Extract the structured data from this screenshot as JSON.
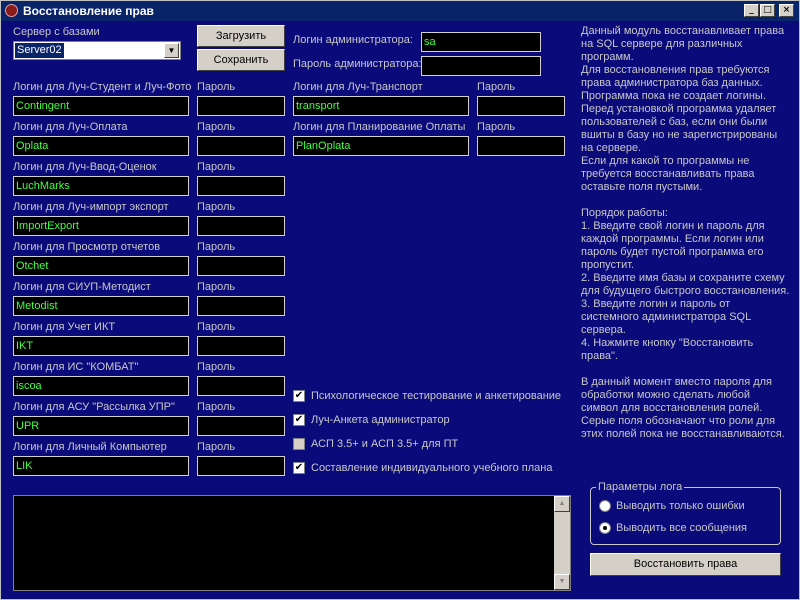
{
  "window": {
    "title": "Восстановление прав",
    "controls": [
      "_",
      "□",
      "×"
    ]
  },
  "server": {
    "label": "Сервер с базами",
    "value": "Server02"
  },
  "buttons": {
    "load": "Загрузить",
    "save": "Сохранить",
    "restore": "Восстановить права"
  },
  "admin": {
    "login_label": "Логин администратора:",
    "login_value": "sa",
    "password_label": "Пароль администратора:",
    "password_value": ""
  },
  "password_label": "Пароль",
  "programs_left": [
    {
      "label": "Логин для Луч-Студент и Луч-Фото",
      "login": "Contingent",
      "password": ""
    },
    {
      "label": "Логин для Луч-Оплата",
      "login": "Oplata",
      "password": ""
    },
    {
      "label": "Логин для Луч-Ввод-Оценок",
      "login": "LuchMarks",
      "password": ""
    },
    {
      "label": "Логин для Луч-импорт экспорт",
      "login": "ImportExport",
      "password": ""
    },
    {
      "label": "Логин для Просмотр отчетов",
      "login": "Otchet",
      "password": ""
    },
    {
      "label": "Логин для СИУП-Методист",
      "login": "Metodist",
      "password": ""
    },
    {
      "label": "Логин для Учет ИКТ",
      "login": "IKT",
      "password": ""
    },
    {
      "label": "Логин для ИС \"КОМБАТ\"",
      "login": "iscoa",
      "password": ""
    },
    {
      "label": "Логин для АСУ \"Рассылка УПР\"",
      "login": "UPR",
      "password": ""
    },
    {
      "label": "Логин для Личный Компьютер",
      "login": "LIK",
      "password": ""
    }
  ],
  "programs_right": [
    {
      "label": "Логин для Луч-Транспорт",
      "login": "transport",
      "password": ""
    },
    {
      "label": "Логин для Планирование Оплаты",
      "login": "PlanOplata",
      "password": ""
    }
  ],
  "checkboxes": [
    {
      "label": "Психологическое тестирование и анкетирование",
      "checked": true
    },
    {
      "label": "Луч-Анкета администратор",
      "checked": true
    },
    {
      "label": "АСП 3.5+ и АСП 3.5+ для ПТ",
      "checked": false
    },
    {
      "label": "Составление индивидуального учебного плана",
      "checked": true
    }
  ],
  "description": [
    "Данный модуль восстанавливает права",
    "на SQL сервере для различных",
    "программ.",
    "Для восстановления прав требуются",
    "права администратора баз данных.",
    "Программа пока не создает логины.",
    "Перед установкой программа удаляет",
    "пользователей с баз, если они были",
    "вшиты в базу но не зарегистрированы",
    "на сервере.",
    "Если для какой то программы не",
    "требуется восстанавливать права",
    "оставьте поля пустыми.",
    "",
    "Порядок работы:",
    "1. Введите свой логин и пароль для",
    "каждой программы. Если логин или",
    "пароль будет пустой программа его",
    "пропустит.",
    "2. Введите имя базы и сохраните схему",
    "для будущего быстрого восстановления.",
    "3. Введите логин и пароль от",
    "системного администратора SQL",
    "сервера.",
    "4. Нажмите кнопку \"Восстановить",
    "права\".",
    "",
    "В данный момент вместо пароля для",
    "обработки можно сделать любой",
    "символ для восстановления ролей.",
    "Серые поля обозначают что роли для",
    "этих полей пока не восстанавливаются."
  ],
  "log_params": {
    "title": "Параметры лога",
    "options": [
      {
        "label": "Выводить только ошибки",
        "selected": false
      },
      {
        "label": "Выводить все сообщения",
        "selected": true
      }
    ]
  },
  "log_text": "",
  "colors": {
    "background": "#0a0a7a",
    "titlebar": "#0a246a",
    "field_text": "#40ff40",
    "label_text": "#c8c8c8"
  }
}
